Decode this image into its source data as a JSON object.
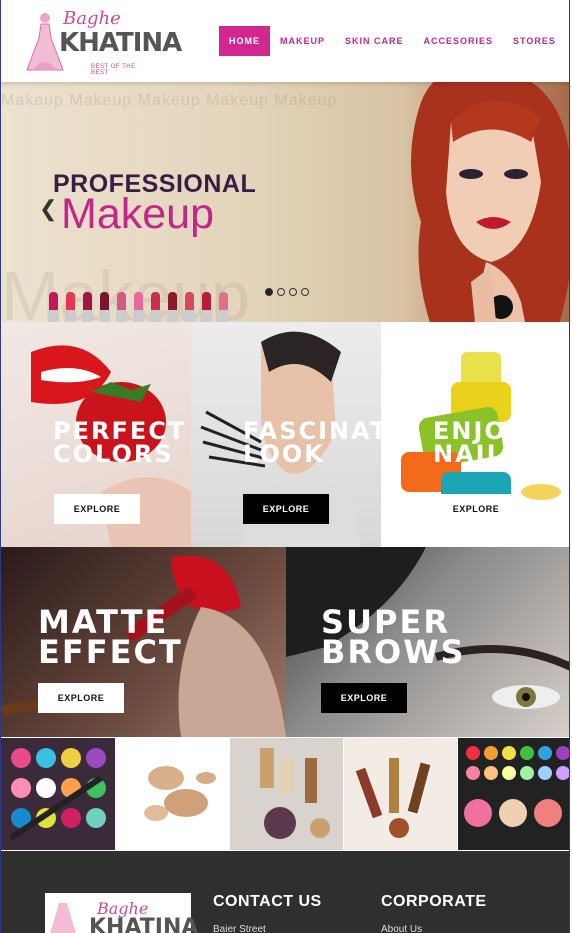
{
  "brand": {
    "script": "Baghe",
    "name": "KHATINA",
    "tagline": "BEST OF THE BEST"
  },
  "nav": [
    {
      "label": "HOME",
      "active": true
    },
    {
      "label": "MAKEUP",
      "active": false
    },
    {
      "label": "SKIN CARE",
      "active": false
    },
    {
      "label": "ACCESORIES",
      "active": false
    },
    {
      "label": "STORES",
      "active": false
    }
  ],
  "hero": {
    "headline": "PROFESSIONAL",
    "subheadline": "Makeup",
    "watermark": "Makeup Makeup Makeup Makeup Makeup",
    "big_watermark": "Makeup",
    "slide_count": 4,
    "active_slide": 1
  },
  "tiles_row1": [
    {
      "title": "PERFECT\nCOLORS",
      "button": "EXPLORE",
      "button_style": "white"
    },
    {
      "title": "FASCINATING\nLOOK",
      "button": "EXPLORE",
      "button_style": "black"
    },
    {
      "title": "ENJOYED\nNAILS",
      "button": "EXPLORE",
      "button_style": "white"
    }
  ],
  "tiles_row2": [
    {
      "title": "MATTE\nEFFECT",
      "button": "EXPLORE",
      "button_style": "white"
    },
    {
      "title": "SUPER\nBROWS",
      "button": "EXPLORE",
      "button_style": "black"
    }
  ],
  "footer": {
    "contact_heading": "CONTACT US",
    "contact_line": "Baier Street",
    "corporate_heading": "CORPORATE",
    "corporate_line": "About Us"
  },
  "colors": {
    "accent": "#d1278e",
    "footer_bg": "#2f2f2f"
  }
}
